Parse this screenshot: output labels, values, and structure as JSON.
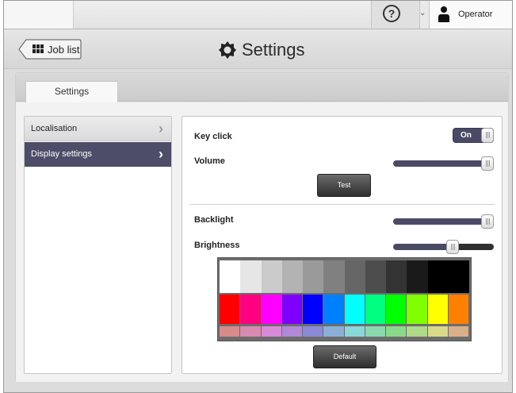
{
  "header": {
    "help_glyph": "?",
    "dropdown_glyph": "⌄",
    "user_name": "Operator"
  },
  "titlebar": {
    "back_label": "Job list",
    "title": "Settings"
  },
  "tabs": [
    {
      "label": "Settings",
      "active": true
    }
  ],
  "menu": {
    "items": [
      {
        "label": "Localisation",
        "selected": false
      },
      {
        "label": "Display settings",
        "selected": true
      }
    ],
    "chevron": "›"
  },
  "settings": {
    "key_click": {
      "label": "Key click",
      "value": "On"
    },
    "volume": {
      "label": "Volume",
      "level": 1.0
    },
    "test_button": "Test",
    "backlight": {
      "label": "Backlight",
      "level": 1.0
    },
    "brightness": {
      "label": "Brightness",
      "level": 0.6
    },
    "default_button": "Default"
  },
  "palette": {
    "grays": [
      "#ffffff",
      "#e6e6e6",
      "#cbcbcb",
      "#b3b3b3",
      "#9a9a9a",
      "#808080",
      "#666666",
      "#4d4d4d",
      "#333333",
      "#1a1a1a",
      "#000000",
      "#000000"
    ],
    "colors": [
      "#ff0000",
      "#ff0080",
      "#ff00ff",
      "#8000ff",
      "#0000ff",
      "#0080ff",
      "#00ffff",
      "#00ff80",
      "#00ff00",
      "#80ff00",
      "#ffff00",
      "#ff8000"
    ],
    "pastels": [
      "#d98a8a",
      "#d98ab0",
      "#d98ad9",
      "#b08ad9",
      "#8a8ad9",
      "#8ab0d9",
      "#8ad9d9",
      "#8ad9b0",
      "#8ad98a",
      "#b0d98a",
      "#d9d98a",
      "#d9b08a"
    ]
  },
  "colors": {
    "accent": "#4d4c69",
    "slider_active": "#4b4a66",
    "slider_inactive": "#303030"
  }
}
